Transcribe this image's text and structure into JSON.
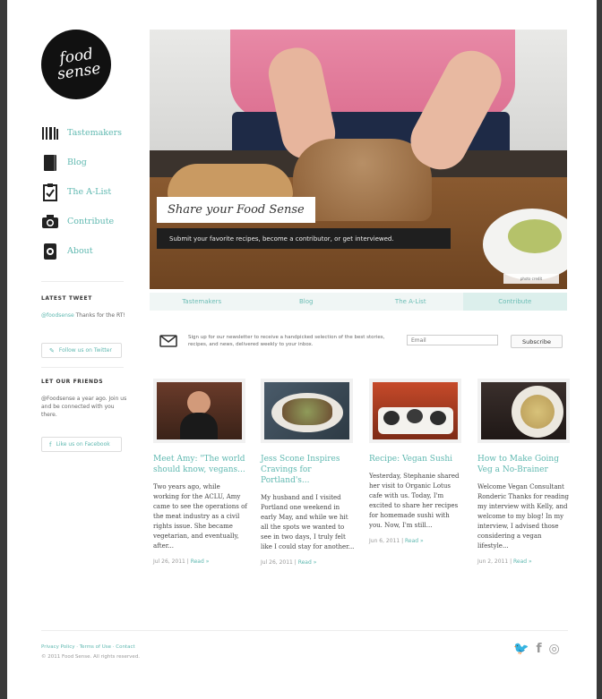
{
  "logo": {
    "line1": "food",
    "line2": "sense"
  },
  "nav": [
    {
      "label": "Tastemakers",
      "icon": "utensils-icon"
    },
    {
      "label": "Blog",
      "icon": "notebook-icon"
    },
    {
      "label": "The A-List",
      "icon": "checklist-icon"
    },
    {
      "label": "Contribute",
      "icon": "camera-icon"
    },
    {
      "label": "About",
      "icon": "phone-icon"
    }
  ],
  "sidebar": {
    "latest_tweet_heading": "LATEST TWEET",
    "tweet_handle": "@foodsense",
    "tweet_text": "Thanks for the RT!",
    "twitter_button": "Follow us on Twitter",
    "facebook_heading": "LET OUR FRIENDS",
    "facebook_text": "@Foodsense a year ago. Join us and be connected with you there.",
    "facebook_button": "Like us on Facebook"
  },
  "hero": {
    "title": "Share your Food Sense",
    "subtitle": "Submit your favorite recipes, become a contributor, or get interviewed.",
    "tag": "photo credit"
  },
  "tabs": [
    "Tastemakers",
    "Blog",
    "The A-List",
    "Contribute"
  ],
  "newsletter": {
    "text": "Sign up for our newsletter to receive a handpicked selection of the best stories, recipes, and news, delivered weekly to your inbox.",
    "placeholder": "Email",
    "button": "Subscribe"
  },
  "posts": [
    {
      "title": "Meet Amy: \"The world should know, vegans...",
      "excerpt": "Two years ago, while working for the ACLU, Amy came to see the operations of the meat industry as a civil rights issue. She became vegetarian, and eventually, after...",
      "date": "Jul 26, 2011",
      "read": "Read »"
    },
    {
      "title": "Jess Scone Inspires Cravings for Portland's...",
      "excerpt": "My husband and I visited Portland one weekend in early May, and while we hit all the spots we wanted to see in two days, I truly felt like I could stay for another...",
      "date": "Jul 26, 2011",
      "read": "Read »"
    },
    {
      "title": "Recipe: Vegan Sushi",
      "excerpt": "Yesterday, Stephanie shared her visit to Organic Lotus cafe with us. Today, I'm excited to share her recipes for homemade sushi with you. Now, I'm still...",
      "date": "Jun 6, 2011",
      "read": "Read »"
    },
    {
      "title": "How to Make Going Veg a No-Brainer",
      "excerpt": "Welcome Vegan Consultant Ronderic Thanks for reading my interview with Kelly, and welcome to my blog! In my interview, I advised those considering a vegan lifestyle...",
      "date": "Jun 2, 2011",
      "read": "Read »"
    }
  ],
  "footer": {
    "links": "Privacy Policy · Terms of Use · Contact",
    "copyright": "© 2011 Food Sense. All rights reserved.",
    "social": [
      "twitter-icon",
      "facebook-icon",
      "rss-icon"
    ]
  },
  "colors": {
    "accent": "#5fb8b0",
    "tab_bg": "#f0f6f5",
    "dark_banner": "#1f1f1f"
  }
}
